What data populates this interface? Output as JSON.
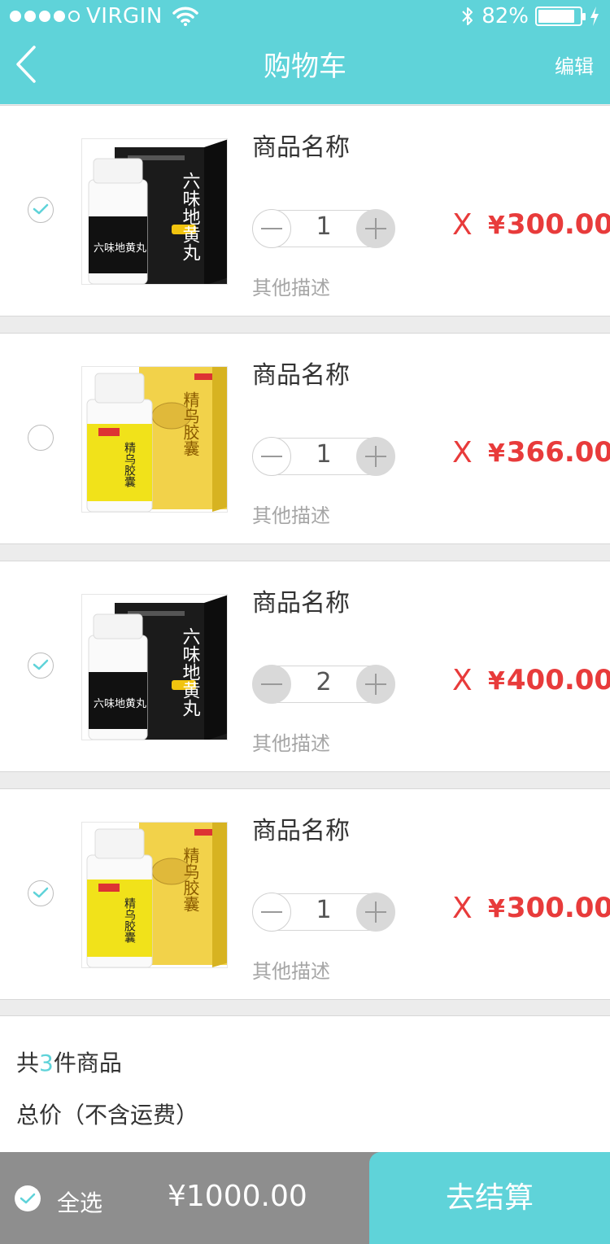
{
  "status_bar": {
    "carrier": "VIRGIN",
    "battery": "82%",
    "signal_dots_filled": 4,
    "signal_dots_total": 5
  },
  "nav": {
    "title": "购物车",
    "edit_label": "编辑",
    "back_icon": "chevron-left-icon"
  },
  "colors": {
    "accent": "#5fd3d9",
    "price": "#e83b3b",
    "bar": "#8e8e8e"
  },
  "items": [
    {
      "checked": true,
      "product": "六味地黄丸",
      "name": "商品名称",
      "quantity": "1",
      "description": "其他描述",
      "times": "X",
      "currency": "¥",
      "price": "300.00"
    },
    {
      "checked": false,
      "product": "精乌胶囊",
      "name": "商品名称",
      "quantity": "1",
      "description": "其他描述",
      "times": "X",
      "currency": "¥",
      "price": "366.00"
    },
    {
      "checked": true,
      "product": "六味地黄丸",
      "name": "商品名称",
      "quantity": "2",
      "description": "其他描述",
      "times": "X",
      "currency": "¥",
      "price": "400.00"
    },
    {
      "checked": true,
      "product": "精乌胶囊",
      "name": "商品名称",
      "quantity": "1",
      "description": "其他描述",
      "times": "X",
      "currency": "¥",
      "price": "300.00"
    }
  ],
  "summary": {
    "count_prefix": "共",
    "count": "3",
    "count_suffix": "件商品",
    "total_label": "总价（不含运费）"
  },
  "bottom_bar": {
    "select_all": "全选",
    "total": "¥1000.00",
    "checkout": "去结算"
  }
}
